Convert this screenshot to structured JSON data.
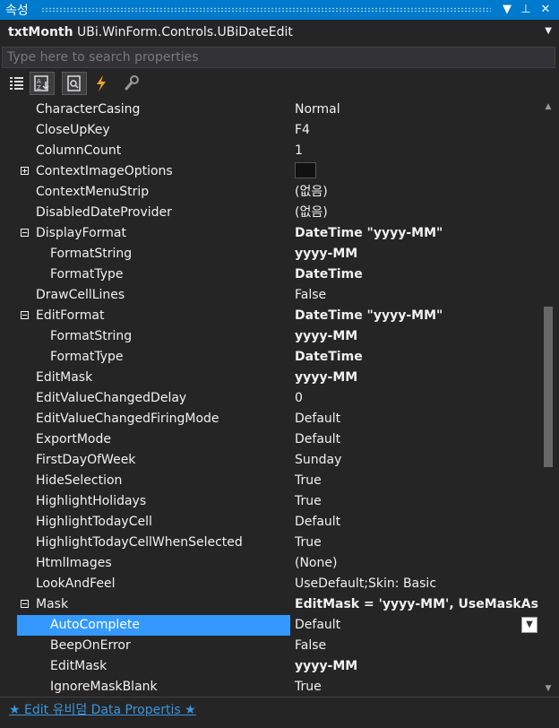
{
  "panel": {
    "title": "속성",
    "dropdown_glyph": "▼",
    "pin_glyph": "⊥",
    "close_glyph": "✕"
  },
  "object_selector": {
    "name": "txtMonth",
    "type": "UBi.WinForm.Controls.UBiDateEdit"
  },
  "search": {
    "placeholder": "Type here to search properties"
  },
  "toolbar": {
    "buttons": [
      {
        "icon": "categorized-icon"
      },
      {
        "icon": "alphabetical-icon"
      },
      {
        "icon": "properties-icon"
      },
      {
        "icon": "events-icon"
      },
      {
        "icon": "property-pages-icon"
      }
    ]
  },
  "colors": {
    "accent": "#007acc",
    "selection": "#3399ff",
    "link": "#3a96dd",
    "background": "#252526"
  },
  "properties": [
    {
      "name": "CharacterCasing",
      "value": "Normal"
    },
    {
      "name": "CloseUpKey",
      "value": "F4"
    },
    {
      "name": "ColumnCount",
      "value": "1"
    },
    {
      "name": "ContextImageOptions",
      "value": "",
      "expander": "plus",
      "swatch": true
    },
    {
      "name": "ContextMenuStrip",
      "value": "(없음)"
    },
    {
      "name": "DisabledDateProvider",
      "value": "(없음)"
    },
    {
      "name": "DisplayFormat",
      "value": "DateTime \"yyyy-MM\"",
      "expander": "minus",
      "bold": true
    },
    {
      "name": "FormatString",
      "value": "yyyy-MM",
      "indent": 1,
      "bold": true
    },
    {
      "name": "FormatType",
      "value": "DateTime",
      "indent": 1,
      "bold": true
    },
    {
      "name": "DrawCellLines",
      "value": "False"
    },
    {
      "name": "EditFormat",
      "value": "DateTime \"yyyy-MM\"",
      "expander": "minus",
      "bold": true
    },
    {
      "name": "FormatString",
      "value": "yyyy-MM",
      "indent": 1,
      "bold": true
    },
    {
      "name": "FormatType",
      "value": "DateTime",
      "indent": 1,
      "bold": true
    },
    {
      "name": "EditMask",
      "value": "yyyy-MM",
      "bold": true
    },
    {
      "name": "EditValueChangedDelay",
      "value": "0"
    },
    {
      "name": "EditValueChangedFiringMode",
      "value": "Default"
    },
    {
      "name": "ExportMode",
      "value": "Default"
    },
    {
      "name": "FirstDayOfWeek",
      "value": "Sunday"
    },
    {
      "name": "HideSelection",
      "value": "True"
    },
    {
      "name": "HighlightHolidays",
      "value": "True"
    },
    {
      "name": "HighlightTodayCell",
      "value": "Default"
    },
    {
      "name": "HighlightTodayCellWhenSelected",
      "value": "True"
    },
    {
      "name": "HtmlImages",
      "value": "(None)"
    },
    {
      "name": "LookAndFeel",
      "value": "UseDefault;Skin: Basic"
    },
    {
      "name": "Mask",
      "value": "EditMask = 'yyyy-MM', UseMaskAsDis",
      "expander": "minus",
      "bold": true
    },
    {
      "name": "AutoComplete",
      "value": "Default",
      "indent": 1,
      "selected": true,
      "dropdown": true
    },
    {
      "name": "BeepOnError",
      "value": "False",
      "indent": 1
    },
    {
      "name": "EditMask",
      "value": "yyyy-MM",
      "indent": 1,
      "bold": true
    },
    {
      "name": "IgnoreMaskBlank",
      "value": "True",
      "indent": 1
    }
  ],
  "scrollbar": {
    "position": 0.5
  },
  "footer": {
    "link": "★ Edit 유비덤 Data Propertis ★"
  }
}
